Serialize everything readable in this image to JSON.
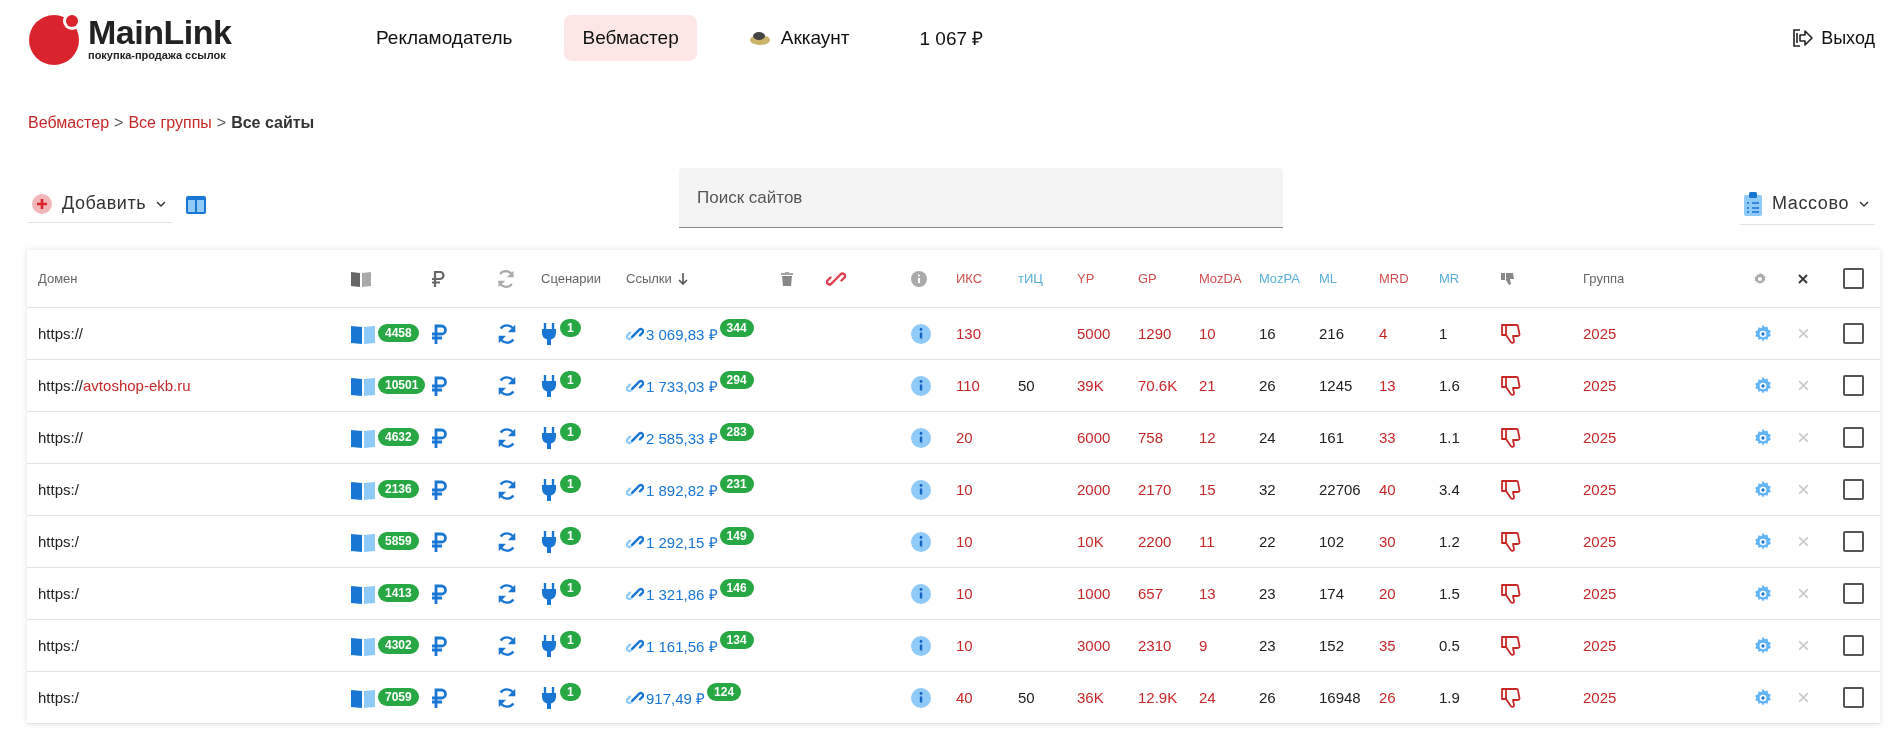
{
  "logo": {
    "name": "MainLink",
    "tagline": "покупка-продажа ссылок"
  },
  "nav": [
    {
      "label": "Рекламодатель",
      "selected": false,
      "kind": "plain"
    },
    {
      "label": "Вебмастер",
      "selected": true,
      "kind": "plain"
    },
    {
      "label": "Аккаунт",
      "selected": false,
      "kind": "account"
    },
    {
      "label": "1 067 ₽",
      "selected": false,
      "kind": "plain"
    }
  ],
  "logout": "Выход",
  "breadcrumbs": [
    {
      "label": "Вебмастер",
      "kind": "link"
    },
    {
      "label": "Все группы",
      "kind": "link"
    },
    {
      "label": "Все сайты",
      "kind": "current"
    }
  ],
  "breadcrumb_separator": ">",
  "add_button": "Добавить",
  "search": {
    "placeholder": "Поиск сайтов"
  },
  "bulk_button": "Массово",
  "table": {
    "domain_header": "Домен",
    "scenarios_header": "Сценарии",
    "links_header": "Ссылки",
    "group_header": "Группа",
    "header_checked": false,
    "metric_columns": [
      {
        "label": "ИКС",
        "kind": "accent"
      },
      {
        "label": "тИЦ",
        "kind": "plain"
      },
      {
        "label": "YP",
        "kind": "accent"
      },
      {
        "label": "GP",
        "kind": "accent"
      },
      {
        "label": "MozDA",
        "kind": "accent"
      },
      {
        "label": "MozPA",
        "kind": "plain"
      },
      {
        "label": "ML",
        "kind": "plain"
      },
      {
        "label": "MRD",
        "kind": "accent"
      },
      {
        "label": "MR",
        "kind": "plain"
      }
    ],
    "rows": [
      {
        "prefix": "https://",
        "pages": "4458",
        "price": "3 069,83 ₽",
        "links": "344",
        "scenarios": "1",
        "metrics": {
          "iks": "130",
          "yp": "5000",
          "gp": "1290",
          "mozda": "10",
          "mozpa": "16",
          "ml": "216",
          "mrd": "4",
          "mr": "1"
        },
        "group": "2025",
        "checked": false
      },
      {
        "prefix": "https://",
        "domain": "avtoshop-ekb.ru",
        "pages": "10501",
        "price": "1 733,03 ₽",
        "links": "294",
        "scenarios": "1",
        "metrics": {
          "iks": "110",
          "tic": "50",
          "yp": "39K",
          "gp": "70.6K",
          "mozda": "21",
          "mozpa": "26",
          "ml": "1245",
          "mrd": "13",
          "mr": "1.6"
        },
        "group": "2025",
        "checked": false
      },
      {
        "prefix": "https://",
        "pages": "4632",
        "price": "2 585,33 ₽",
        "links": "283",
        "scenarios": "1",
        "metrics": {
          "iks": "20",
          "yp": "6000",
          "gp": "758",
          "mozda": "12",
          "mozpa": "24",
          "ml": "161",
          "mrd": "33",
          "mr": "1.1"
        },
        "group": "2025",
        "checked": false
      },
      {
        "prefix": "https:/",
        "pages": "2136",
        "price": "1 892,82 ₽",
        "links": "231",
        "scenarios": "1",
        "metrics": {
          "iks": "10",
          "yp": "2000",
          "gp": "2170",
          "mozda": "15",
          "mozpa": "32",
          "ml": "22706",
          "mrd": "40",
          "mr": "3.4"
        },
        "group": "2025",
        "checked": false
      },
      {
        "prefix": "https:/",
        "pages": "5859",
        "price": "1 292,15 ₽",
        "links": "149",
        "scenarios": "1",
        "metrics": {
          "iks": "10",
          "yp": "10K",
          "gp": "2200",
          "mozda": "11",
          "mozpa": "22",
          "ml": "102",
          "mrd": "30",
          "mr": "1.2"
        },
        "group": "2025",
        "checked": false
      },
      {
        "prefix": "https:/",
        "pages": "1413",
        "price": "1 321,86 ₽",
        "links": "146",
        "scenarios": "1",
        "metrics": {
          "iks": "10",
          "yp": "1000",
          "gp": "657",
          "mozda": "13",
          "mozpa": "23",
          "ml": "174",
          "mrd": "20",
          "mr": "1.5"
        },
        "group": "2025",
        "checked": false
      },
      {
        "prefix": "https:/",
        "pages": "4302",
        "price": "1 161,56 ₽",
        "links": "134",
        "scenarios": "1",
        "metrics": {
          "iks": "10",
          "yp": "3000",
          "gp": "2310",
          "mozda": "9",
          "mozpa": "23",
          "ml": "152",
          "mrd": "35",
          "mr": "0.5"
        },
        "group": "2025",
        "checked": false
      },
      {
        "prefix": "https:/",
        "pages": "7059",
        "price": "917,49 ₽",
        "links": "124",
        "scenarios": "1",
        "metrics": {
          "iks": "40",
          "tic": "50",
          "yp": "36K",
          "gp": "12.9K",
          "mozda": "24",
          "mozpa": "26",
          "ml": "16948",
          "mrd": "26",
          "mr": "1.9"
        },
        "group": "2025",
        "checked": false
      }
    ]
  }
}
